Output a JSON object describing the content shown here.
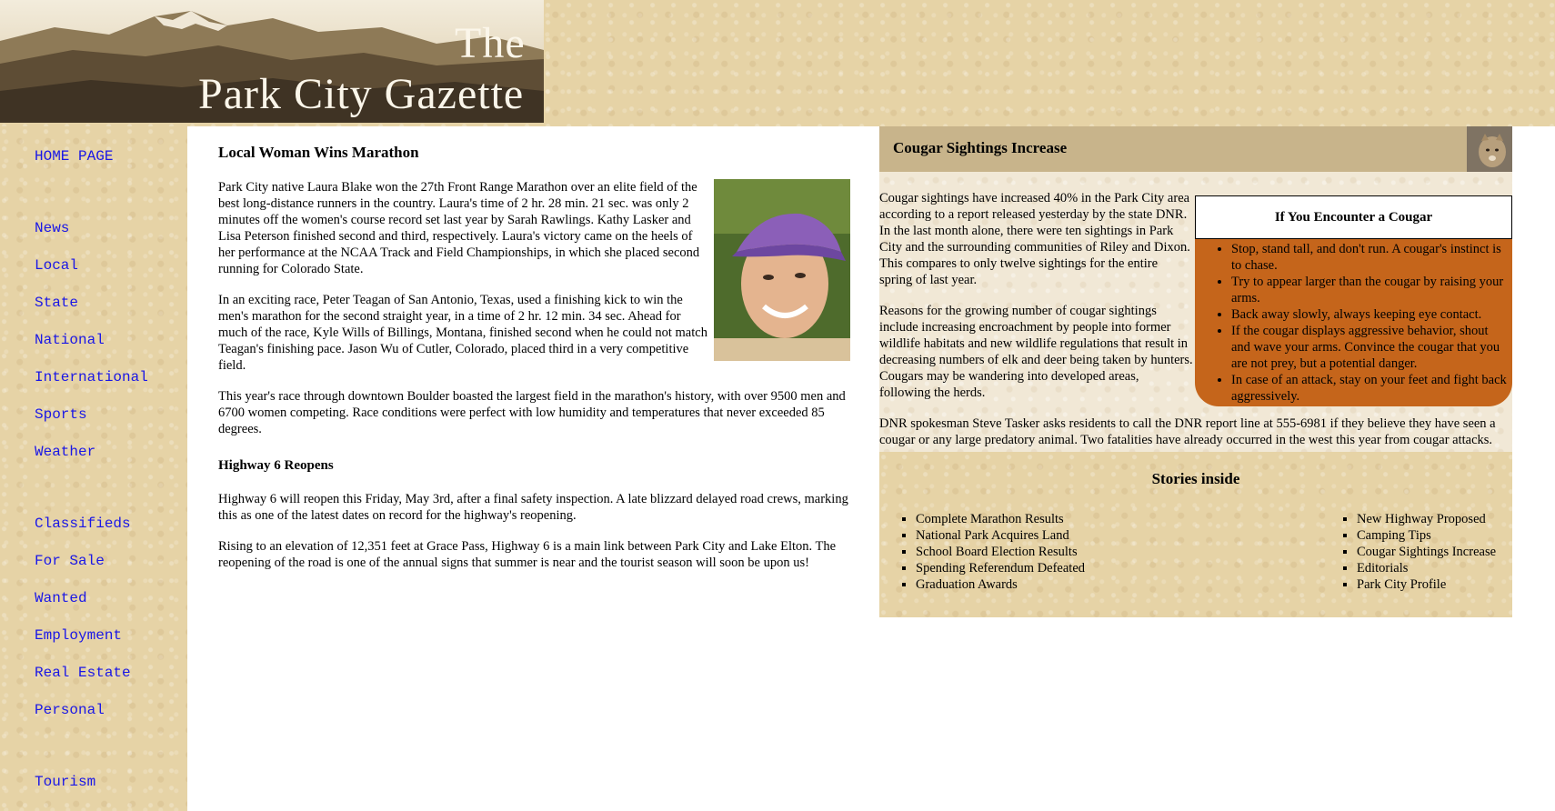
{
  "banner": {
    "title_line1": "The",
    "title_line2": "Park City Gazette"
  },
  "nav": {
    "home": "HOME PAGE",
    "news": "News",
    "local": "Local",
    "state": "State",
    "national": "National",
    "international": "International",
    "sports": "Sports",
    "weather": "Weather",
    "classifieds": "Classifieds",
    "for_sale": "For Sale",
    "wanted": "Wanted",
    "employment": "Employment",
    "real_estate": "Real Estate",
    "personal": "Personal",
    "tourism": "Tourism"
  },
  "main": {
    "marathon": {
      "headline": "Local Woman Wins Marathon",
      "p1": "Park City native Laura Blake won the 27th Front Range Marathon over an elite field of the best long-distance runners in the country. Laura's time of 2 hr. 28 min. 21 sec. was only 2 minutes off the women's course record set last year by Sarah Rawlings. Kathy Lasker and Lisa Peterson finished second and third, respectively. Laura's victory came on the heels of her performance at the NCAA Track and Field Championships, in which she placed second running for Colorado State.",
      "p2": "In an exciting race, Peter Teagan of San Antonio, Texas, used a finishing kick to win the men's marathon for the second straight year, in a time of 2 hr. 12 min. 34 sec. Ahead for much of the race, Kyle Wills of Billings, Montana, finished second when he could not match Teagan's finishing pace. Jason Wu of Cutler, Colorado, placed third in a very competitive field.",
      "p3": "This year's race through downtown Boulder boasted the largest field in the marathon's history, with over 9500 men and 6700 women competing. Race conditions were perfect with low humidity and temperatures that never exceeded 85 degrees."
    },
    "highway": {
      "headline": "Highway 6 Reopens",
      "p1": "Highway 6 will reopen this Friday, May 3rd, after a final safety inspection. A late blizzard delayed road crews, marking this as one of the latest dates on record for the highway's reopening.",
      "p2": "Rising to an elevation of 12,351 feet at Grace Pass, Highway 6 is a main link between Park City and Lake Elton. The reopening of the road is one of the annual signs that summer is near and the tourist season will soon be upon us!"
    }
  },
  "cougar": {
    "headline": "Cougar Sightings Increase",
    "p1": "Cougar sightings have increased 40% in the Park City area according to a report released yesterday by the state DNR. In the last month alone, there were ten sightings in Park City and the surrounding communities of Riley and Dixon. This compares to only twelve sightings for the entire spring of last year.",
    "p2": "Reasons for the growing number of cougar sightings include increasing encroachment by people into former wildlife habitats and new wildlife regulations that result in decreasing numbers of elk and deer being taken by hunters. Cougars may be wandering into developed areas, following the herds.",
    "p3": "DNR spokesman Steve Tasker asks residents to call the DNR report line at 555-6981 if they believe they have seen a cougar or any large predatory animal. Two fatalities have already occurred in the west this year from cougar attacks.",
    "sidebar": {
      "title": "If You Encounter a Cougar",
      "tips": [
        "Stop, stand tall, and don't run. A cougar's instinct is to chase.",
        "Try to appear larger than the cougar by raising your arms.",
        "Back away slowly, always keeping eye contact.",
        "If the cougar displays aggressive behavior, shout and wave your arms. Convince the cougar that you are not prey, but a potential danger.",
        "In case of an attack, stay on your feet and fight back aggressively."
      ]
    }
  },
  "stories": {
    "title": "Stories inside",
    "left": [
      "Complete Marathon Results",
      "National Park Acquires Land",
      "School Board Election Results",
      "Spending Referendum Defeated",
      "Graduation Awards"
    ],
    "right": [
      "New Highway Proposed",
      "Camping Tips",
      "Cougar Sightings Increase",
      "Editorials",
      "Park City Profile"
    ]
  },
  "colors": {
    "link": "#1a17e6",
    "parchment": "#e6d3a6",
    "cougar_header": "#c8b48b",
    "encounter_box": "#c5651b"
  }
}
